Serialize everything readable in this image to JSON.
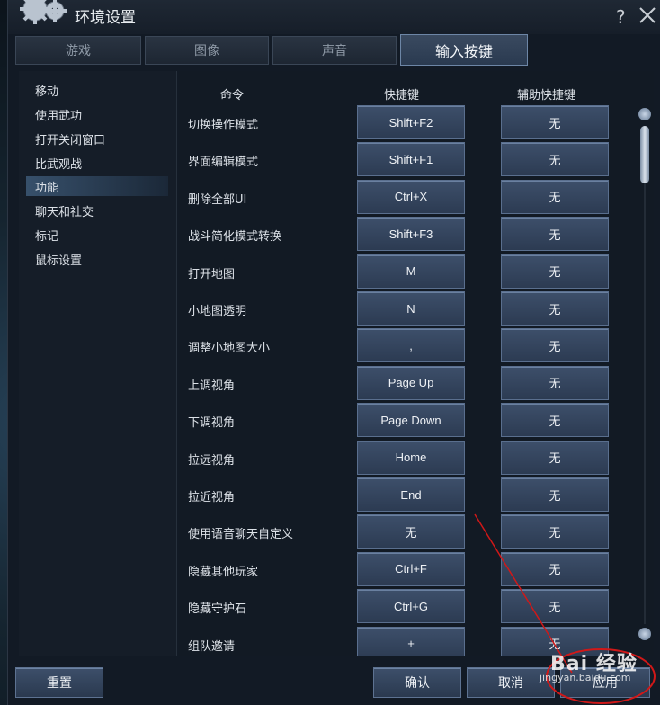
{
  "window": {
    "title": "环境设置"
  },
  "tabs": [
    {
      "label": "游戏"
    },
    {
      "label": "图像"
    },
    {
      "label": "声音"
    },
    {
      "label": "输入按键"
    }
  ],
  "categories": [
    {
      "label": "移动"
    },
    {
      "label": "使用武功"
    },
    {
      "label": "打开关闭窗口"
    },
    {
      "label": "比武观战"
    },
    {
      "label": "功能"
    },
    {
      "label": "聊天和社交"
    },
    {
      "label": "标记"
    },
    {
      "label": "鼠标设置"
    }
  ],
  "active_category": "功能",
  "columns": {
    "command": "命令",
    "shortcut": "快捷键",
    "alt_shortcut": "辅助快捷键"
  },
  "rows": [
    {
      "command": "切换操作模式",
      "key": "Shift+F2",
      "alt": "无"
    },
    {
      "command": "界面编辑模式",
      "key": "Shift+F1",
      "alt": "无"
    },
    {
      "command": "删除全部UI",
      "key": "Ctrl+X",
      "alt": "无"
    },
    {
      "command": "战斗简化模式转换",
      "key": "Shift+F3",
      "alt": "无"
    },
    {
      "command": "打开地图",
      "key": "M",
      "alt": "无"
    },
    {
      "command": "小地图透明",
      "key": "N",
      "alt": "无"
    },
    {
      "command": "调整小地图大小",
      "key": ",",
      "alt": "无"
    },
    {
      "command": "上调视角",
      "key": "Page Up",
      "alt": "无"
    },
    {
      "command": "下调视角",
      "key": "Page Down",
      "alt": "无"
    },
    {
      "command": "拉远视角",
      "key": "Home",
      "alt": "无"
    },
    {
      "command": "拉近视角",
      "key": "End",
      "alt": "无"
    },
    {
      "command": "使用语音聊天自定义",
      "key": "无",
      "alt": "无"
    },
    {
      "command": "隐藏其他玩家",
      "key": "Ctrl+F",
      "alt": "无"
    },
    {
      "command": "隐藏守护石",
      "key": "Ctrl+G",
      "alt": "无"
    },
    {
      "command": "组队邀请",
      "key": "+",
      "alt": "无"
    }
  ],
  "buttons": {
    "reset": "重置",
    "confirm": "确认",
    "cancel": "取消",
    "apply": "应用"
  },
  "watermark": {
    "brand": "Bai 经验",
    "url": "jingyan.baidu.com"
  },
  "colors": {
    "accent": "#3d4f6a",
    "annotation": "#d01818",
    "panel": "#121a24"
  }
}
